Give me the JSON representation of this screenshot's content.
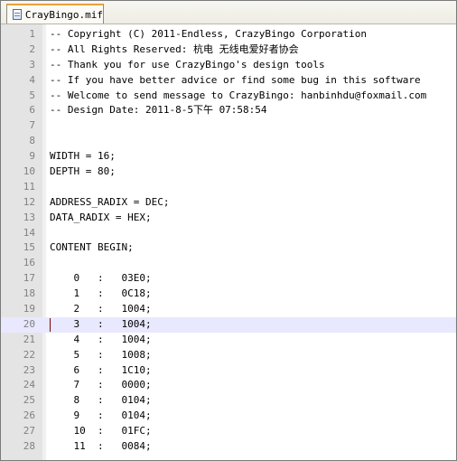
{
  "tab": {
    "title": "CrayBingo.mif"
  },
  "editor": {
    "current_line": 20,
    "lines": [
      {
        "n": "1",
        "text": "-- Copyright (C) 2011-Endless, CrazyBingo Corporation"
      },
      {
        "n": "2",
        "text": "-- All Rights Reserved: 杭电 无线电爱好者协会"
      },
      {
        "n": "3",
        "text": "-- Thank you for use CrazyBingo's design tools"
      },
      {
        "n": "4",
        "text": "-- If you have better advice or find some bug in this software"
      },
      {
        "n": "5",
        "text": "-- Welcome to send message to CrazyBingo: hanbinhdu@foxmail.com"
      },
      {
        "n": "6",
        "text": "-- Design Date: 2011-8-5下午 07:58:54"
      },
      {
        "n": "7",
        "text": ""
      },
      {
        "n": "8",
        "text": ""
      },
      {
        "n": "9",
        "text": "WIDTH = 16;"
      },
      {
        "n": "10",
        "text": "DEPTH = 80;"
      },
      {
        "n": "11",
        "text": ""
      },
      {
        "n": "12",
        "text": "ADDRESS_RADIX = DEC;"
      },
      {
        "n": "13",
        "text": "DATA_RADIX = HEX;"
      },
      {
        "n": "14",
        "text": ""
      },
      {
        "n": "15",
        "text": "CONTENT BEGIN;"
      },
      {
        "n": "16",
        "text": ""
      },
      {
        "n": "17",
        "text": "    0   :   03E0;"
      },
      {
        "n": "18",
        "text": "    1   :   0C18;"
      },
      {
        "n": "19",
        "text": "    2   :   1004;"
      },
      {
        "n": "20",
        "text": "    3   :   1004;"
      },
      {
        "n": "21",
        "text": "    4   :   1004;"
      },
      {
        "n": "22",
        "text": "    5   :   1008;"
      },
      {
        "n": "23",
        "text": "    6   :   1C10;"
      },
      {
        "n": "24",
        "text": "    7   :   0000;"
      },
      {
        "n": "25",
        "text": "    8   :   0104;"
      },
      {
        "n": "26",
        "text": "    9   :   0104;"
      },
      {
        "n": "27",
        "text": "    10  :   01FC;"
      },
      {
        "n": "28",
        "text": "    11  :   0084;"
      }
    ]
  }
}
